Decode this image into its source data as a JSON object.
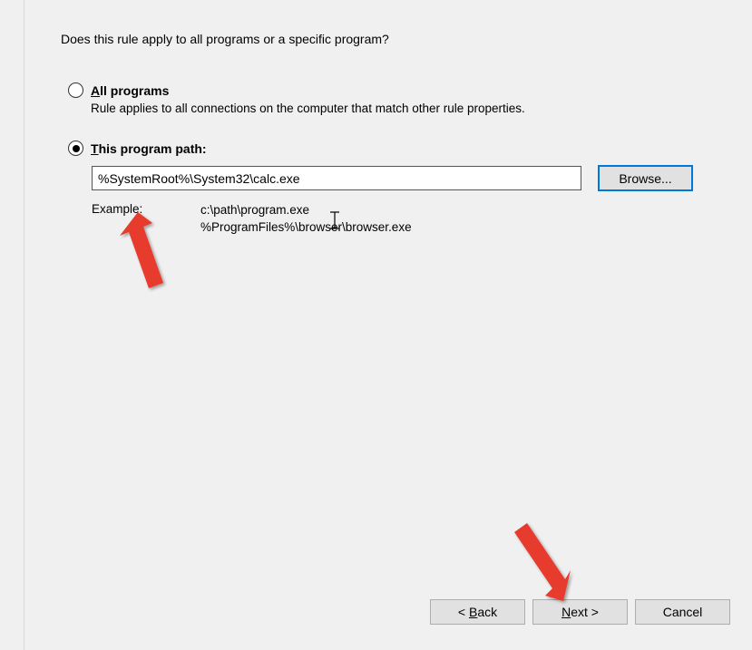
{
  "question": "Does this rule apply to all programs or a specific program?",
  "options": {
    "all": {
      "label_pre": "A",
      "label_post": "ll programs",
      "desc": "Rule applies to all connections on the computer that match other rule properties."
    },
    "this": {
      "label_pre": "T",
      "label_post": "his program path:"
    }
  },
  "path_input": {
    "value": "%SystemRoot%\\System32\\calc.exe"
  },
  "browse_label": "Browse...",
  "example": {
    "label": "Example:",
    "line1": "c:\\path\\program.exe",
    "line2": "%ProgramFiles%\\browser\\browser.exe"
  },
  "buttons": {
    "back_pre": "< ",
    "back_u": "B",
    "back_post": "ack",
    "next_u": "N",
    "next_post": "ext >",
    "cancel": "Cancel"
  }
}
